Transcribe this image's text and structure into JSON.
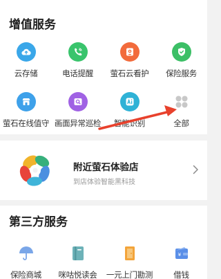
{
  "value_added": {
    "title": "增值服务",
    "items": [
      {
        "label": "云存储",
        "icon": "cloud-upload-icon",
        "color": "#3aa7e9"
      },
      {
        "label": "电话提醒",
        "icon": "phone-icon",
        "color": "#39c46c"
      },
      {
        "label": "萤石云看护",
        "icon": "camera-icon",
        "color": "#f26b3c"
      },
      {
        "label": "保险服务",
        "icon": "shield-check-icon",
        "color": "#3cbf66"
      },
      {
        "label": "萤石在线值守",
        "icon": "shop-icon",
        "color": "#3ea1ea"
      },
      {
        "label": "画面异常巡检",
        "icon": "inspect-icon",
        "color": "#a062e4"
      },
      {
        "label": "智能识别",
        "icon": "ai-icon",
        "color": "#2fb2d6"
      },
      {
        "label": "全部",
        "icon": "grid-icon",
        "color": "#c8c8c8"
      }
    ]
  },
  "store": {
    "title": "附近萤石体验店",
    "subtitle": "到店体验智能黑科技",
    "logo_icon": "ezviz-logo-icon",
    "arrow_icon": "chevron-right-icon"
  },
  "third_party": {
    "title": "第三方服务",
    "items": [
      {
        "label": "保险商城",
        "icon": "umbrella-icon",
        "color": "#7aa6e8"
      },
      {
        "label": "咪咕悦读会",
        "icon": "book-icon",
        "color": "#6db2b8"
      },
      {
        "label": "一元上门勘测",
        "icon": "door-icon",
        "color": "#f3a43a"
      },
      {
        "label": "借钱",
        "icon": "wallet-icon",
        "color": "#5a8fe8"
      }
    ]
  },
  "annotation": {
    "arrow_color": "#e8412c",
    "arrow_icon": "red-arrow-annotation"
  }
}
